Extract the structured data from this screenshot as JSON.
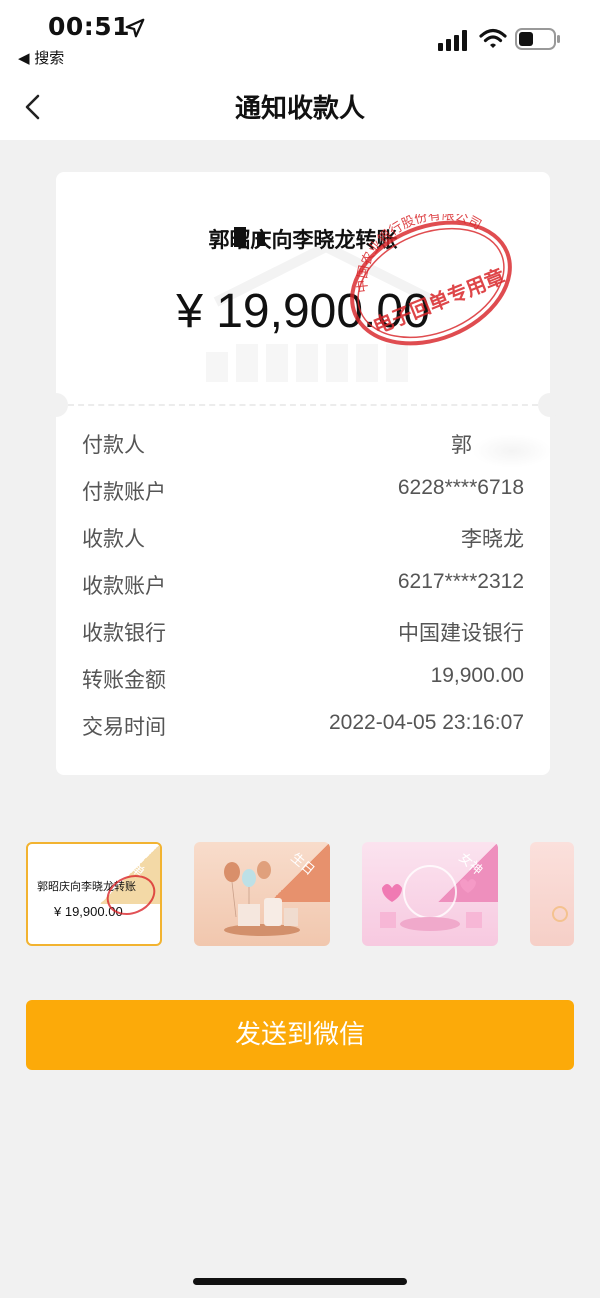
{
  "status_bar": {
    "time": "00:51",
    "back_app": "◀ 搜索"
  },
  "nav": {
    "title": "通知收款人"
  },
  "receipt": {
    "title": "郭昭庆向李晓龙转账",
    "amount": "¥ 19,900.00",
    "seal_text": "电子回单专用章",
    "seal_org": "中国农业银行股份有限公司",
    "details": [
      {
        "label": "付款人",
        "value": "郭"
      },
      {
        "label": "付款账户",
        "value": "6228****6718"
      },
      {
        "label": "收款人",
        "value": "李晓龙"
      },
      {
        "label": "收款账户",
        "value": "6217****2312"
      },
      {
        "label": "收款银行",
        "value": "中国建设银行"
      },
      {
        "label": "转账金额",
        "value": "19,900.00"
      },
      {
        "label": "交易时间",
        "value": "2022-04-05 23:16:07"
      }
    ]
  },
  "templates": [
    {
      "tag": "回单",
      "title": "郭昭庆向李晓龙转账",
      "amount": "¥ 19,900.00",
      "selected": true
    },
    {
      "tag": "生日",
      "selected": false
    },
    {
      "tag": "女神",
      "selected": false
    },
    {
      "tag": "",
      "selected": false
    }
  ],
  "send_button": {
    "label": "发送到微信"
  },
  "colors": {
    "accent": "#fcaa09",
    "selected_border": "#f2b330",
    "seal_red": "#d9262a",
    "background": "#f1f1f1"
  }
}
